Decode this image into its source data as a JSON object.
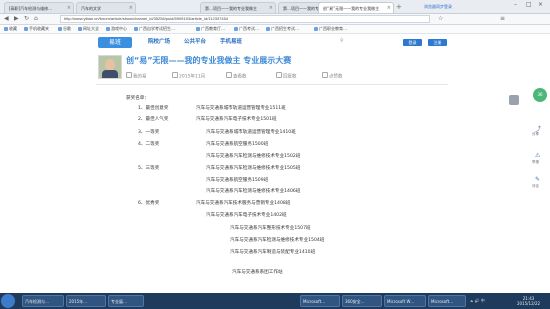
{
  "browser": {
    "tabs": [
      {
        "label": "[高职]汽车检测与维修…",
        "active": false
      },
      {
        "label": "汽车的文学",
        "active": false
      },
      {
        "label": "第…项目——我的专业我做主",
        "active": false
      },
      {
        "label": "第…项目——我的专业我做主",
        "active": false
      },
      {
        "label": "创“易”无限——我的专业我做主",
        "active": true
      }
    ],
    "new_tab": "+",
    "sync_label": "浏览器同步登录",
    "url": "http://www.yiban.cn/forum/article/show/channel_id/35256/puid/5909153/article_id/112337454",
    "bookmarks": [
      "收藏",
      "手机收藏夹",
      "谷歌",
      "网址大全",
      "游戏中心",
      "广西自学考试招生…",
      "广西教育厅…",
      "广西考试…",
      "广西招生考试…",
      "广西职业教育…"
    ]
  },
  "site": {
    "logo_text": "易班",
    "nav": [
      "院校广场",
      "公共平台",
      "手机易班"
    ],
    "search_icon": "search-icon",
    "login_label": "登录",
    "register_label": "注册"
  },
  "article": {
    "title": "创“易”无限——我的专业我做主 专业展示大赛",
    "meta": [
      "我的易",
      "2015年11月",
      "查看数",
      "回复数",
      "点赞数"
    ]
  },
  "content": {
    "heading": "获奖名单：",
    "lines": [
      {
        "label": "1、最佳创意奖",
        "value": "汽车与交通系城市轨道运营管理专业1511班"
      },
      {
        "label": "2、最佳人气奖",
        "value": "汽车与交通系汽车电子技术专业1501班"
      },
      {
        "label": "3、一等奖",
        "value": "汽车与交通系城市轨道运营管理专业1410班"
      },
      {
        "label": "4、二等奖",
        "value": "汽车与交通系航空服务1500班"
      },
      {
        "label": "",
        "value": "汽车与交通系汽车检测与维修技术专业1502班"
      },
      {
        "label": "5、三等奖",
        "value": "汽车与交通系汽车检测与维修技术专业1505班"
      },
      {
        "label": "",
        "value": "汽车与交通系航空服务1509班"
      },
      {
        "label": "",
        "value": "汽车与交通系汽车检测与维修技术专业1406班"
      },
      {
        "label": "6、优秀奖",
        "value": "汽车与交通系汽车技术服务与营销专业1408班"
      },
      {
        "label": "",
        "value": "汽车与交通系汽车电子技术专业1402班"
      },
      {
        "label": "",
        "value": "汽车与交通系汽车整形技术专业1507班"
      },
      {
        "label": "",
        "value": "汽车与交通系汽车检测与维修技术专业1504班"
      },
      {
        "label": "",
        "value": "汽车与交通系汽车制造与装配专业1410班"
      }
    ],
    "footer": "汽车与交通系系团工作站"
  },
  "side": {
    "speed": "36",
    "labels": [
      "分享",
      "举报",
      "评论"
    ]
  },
  "taskbar": {
    "tasks": [
      "汽车检测与…",
      "2015年…",
      "专业展…",
      "Microsoft…",
      "360安全…",
      "Microsoft W…",
      "Microsoft…"
    ],
    "time": "21:43",
    "date": "2015/12/22",
    "tray": "⏶ 🔊 中"
  }
}
